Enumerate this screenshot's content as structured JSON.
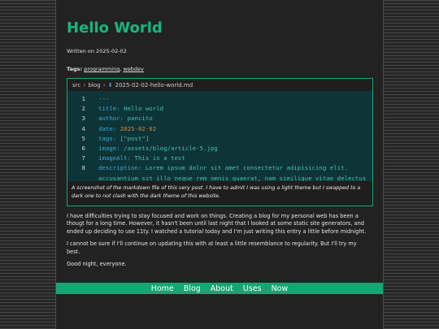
{
  "post": {
    "title": "Hello World",
    "written_on": "Written on 2025-02-02",
    "tags_label": "Tags:",
    "tags": [
      "programming",
      "webdev"
    ],
    "tag_separator": ", "
  },
  "figure": {
    "breadcrumb": [
      "src",
      "blog",
      "2025-02-02-hello-world.md"
    ],
    "line_numbers": [
      "1",
      "2",
      "3",
      "4",
      "5",
      "6",
      "7",
      "8"
    ],
    "code": {
      "fence": "---",
      "title_key": "title:",
      "title_val": "Hello world",
      "author_key": "author:",
      "author_val": "pancito",
      "date_key": "date:",
      "date_val": "2025-02-02",
      "tags_key": "tags:",
      "tags_open": "[",
      "tags_val": "\"post\"",
      "tags_close": "]",
      "image_key": "image:",
      "image_val": "/assets/blog/article-5.jpg",
      "imagealt_key": "imageAlt:",
      "imagealt_val": "This is a test",
      "desc_key": "description:",
      "desc_val": "Lorem ipsum dolor sit amet consectetur adipisicing elit.",
      "desc_cont": "accusantium sit illo neque rem omnis quaerat, nam similique vitae delectus"
    },
    "caption": "A screenshot of the markdown file of this very post. I have to admit I was using a light theme but I swapped to a dark one to not clash with the dark theme of this website."
  },
  "body": {
    "paragraphs": [
      "I have difficulties trying to stay focused and work on things. Creating a blog for my personal web has been a thougt for a long time. However, it hasn't been until last night that I looked at some static site generators, and ended up deciding to use 11ty. I watched a tutorial today and I'm just writing this entry a little before midnight.",
      "I cannot be sure if I'll continue on updating this with at least a little resemblance to regularity. But I'll try my best.",
      "Good night, everyone."
    ]
  },
  "nav": {
    "items": [
      "Home",
      "Blog",
      "About",
      "Uses",
      "Now"
    ]
  },
  "colors": {
    "accent": "#14b87e",
    "nav_bg": "#16a672",
    "page_bg": "#222222",
    "code_bg": "#0d3437"
  },
  "icons": [
    "chevron-right-icon",
    "markdown-file-icon"
  ]
}
